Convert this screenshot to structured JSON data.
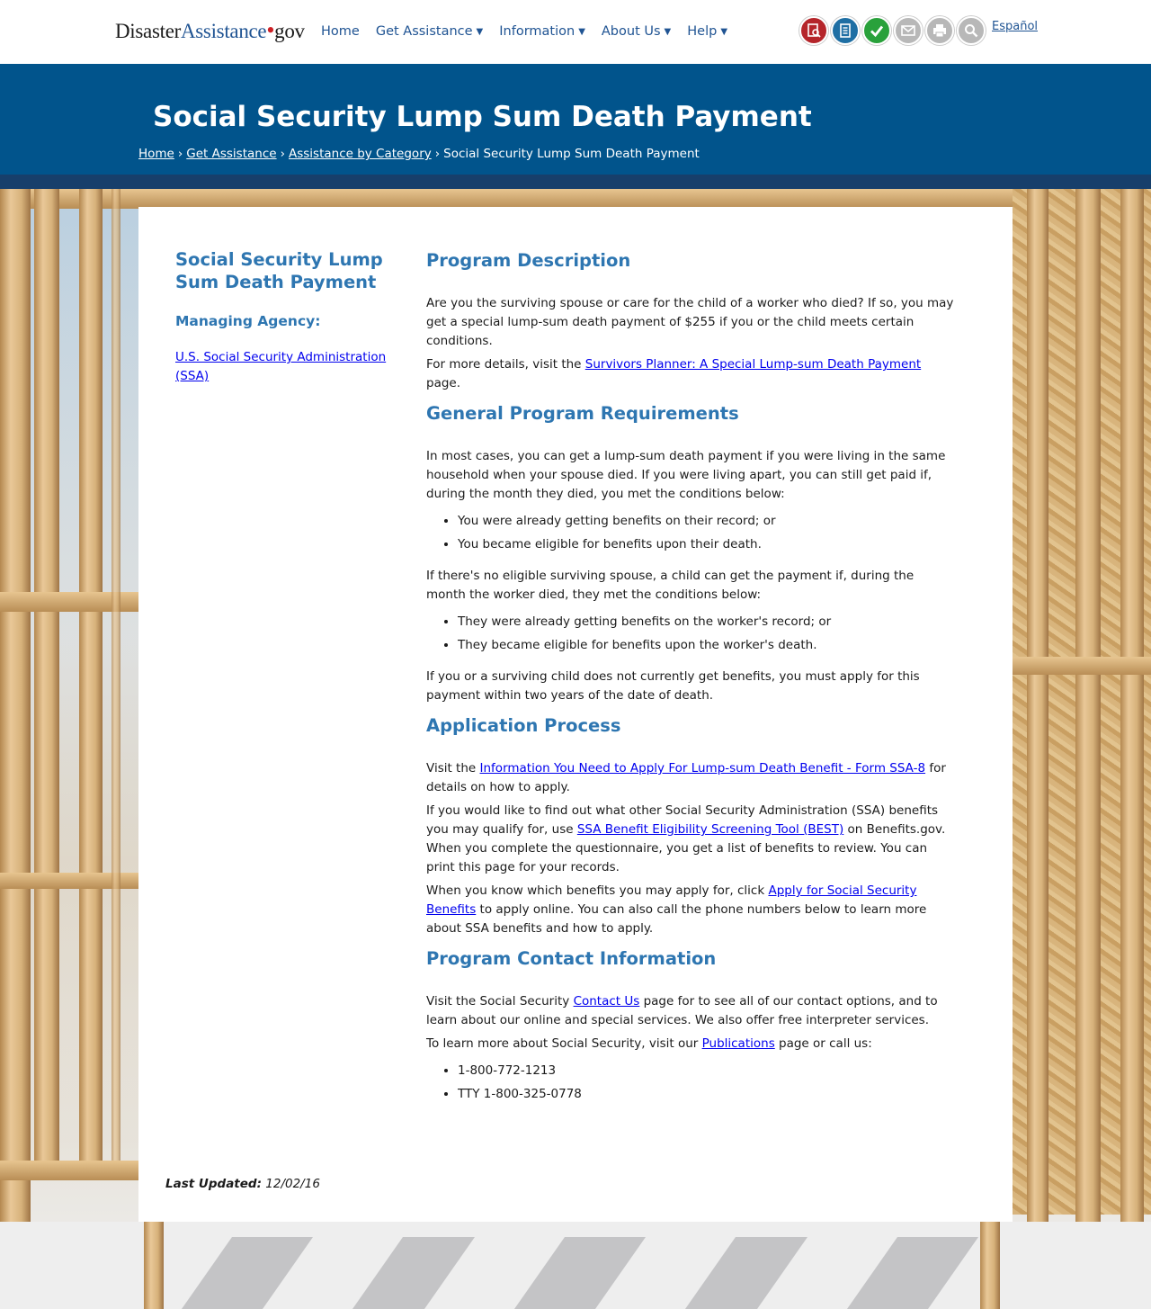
{
  "header": {
    "logo": {
      "part1": "Disaster",
      "part2": "Assistance",
      "dot": "•",
      "part3": "gov"
    },
    "nav": [
      {
        "label": "Home",
        "dropdown": false
      },
      {
        "label": "Get Assistance",
        "dropdown": true
      },
      {
        "label": "Information",
        "dropdown": true
      },
      {
        "label": "About Us",
        "dropdown": true
      },
      {
        "label": "Help",
        "dropdown": true
      }
    ],
    "tools": [
      {
        "icon": "find-assistance-icon",
        "color": "#b5252a"
      },
      {
        "icon": "apply-checklist-icon",
        "color": "#1f6fa4"
      },
      {
        "icon": "check-status-icon",
        "color": "#29a13b"
      },
      {
        "icon": "email-icon",
        "color": "#b8b8b8"
      },
      {
        "icon": "print-icon",
        "color": "#b8b8b8"
      },
      {
        "icon": "search-icon",
        "color": "#b8b8b8"
      }
    ],
    "language_link": "Español"
  },
  "banner": {
    "title": "Social Security Lump Sum Death Payment",
    "breadcrumb": {
      "home": "Home",
      "get_assistance": "Get Assistance",
      "category": "Assistance by Category",
      "current": "Social Security Lump Sum Death Payment",
      "separator": "›"
    }
  },
  "sidebar": {
    "title": "Social Security Lump Sum Death Payment",
    "agency_label": "Managing Agency:",
    "agency_link": "U.S. Social Security Administration (SSA)"
  },
  "content": {
    "description": {
      "heading": "Program Description",
      "p1": "Are you the surviving spouse or care for the child of a worker who died? If so, you may get a special lump-sum death payment of $255 if you or the child meets certain conditions.",
      "p2_before": "For more details, visit the ",
      "p2_link": "Survivors Planner: A Special Lump-sum Death Payment",
      "p2_after": " page."
    },
    "requirements": {
      "heading": "General Program Requirements",
      "p1": "In most cases, you can get a lump-sum death payment if you were living in the same household when your spouse died. If you were living apart, you can still get paid if, during the month they died, you met the conditions below:",
      "list1": [
        "You were already getting benefits on their record; or",
        "You became eligible for benefits upon their death."
      ],
      "p2": "If there's no eligible surviving spouse, a child can get the payment if, during the month the worker died, they met the conditions below:",
      "list2": [
        "They were already getting benefits on the worker's record; or",
        "They became eligible for benefits upon the worker's death."
      ],
      "p3": "If you or a surviving child does not currently get benefits, you must apply for this payment within two years of the date of death."
    },
    "application": {
      "heading": "Application Process",
      "p1_before": "Visit the ",
      "p1_link": "Information You Need to Apply For Lump-sum Death Benefit - Form SSA-8",
      "p1_after": " for details on how to apply.",
      "p2_before": "If you would like to find out what other Social Security Administration (SSA) benefits you may qualify for, use ",
      "p2_link": "SSA Benefit Eligibility Screening Tool (BEST)",
      "p2_after": " on Benefits.gov. When you complete the questionnaire, you get a list of benefits to review. You can print this page for your records.",
      "p3_before": "When you know which benefits you may apply for, click ",
      "p3_link": "Apply for Social Security Benefits",
      "p3_after": " to apply online. You can also call the phone numbers below to learn more about SSA benefits and how to apply."
    },
    "contact": {
      "heading": "Program Contact Information",
      "p1_before": "Visit the Social Security ",
      "p1_link": "Contact Us",
      "p1_after": " page for to see all of our contact options, and to learn about our online and special services. We also offer free interpreter services.",
      "p2_before": "To learn more about Social Security, visit our ",
      "p2_link": "Publications",
      "p2_after": " page or call us:",
      "phones": [
        "1-800-772-1213",
        "TTY 1-800-325-0778"
      ]
    }
  },
  "footer": {
    "last_updated_label": "Last Updated:",
    "last_updated_value": "12/02/16"
  },
  "colors": {
    "brand_blue": "#205493",
    "banner": "#01548c",
    "heading": "#2e76b1",
    "logo_dot": "#cd2026"
  }
}
